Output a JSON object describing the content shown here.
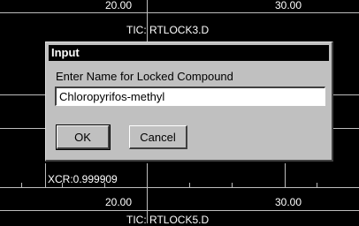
{
  "plot_top": {
    "tick_left": "20.00",
    "tick_right": "30.00",
    "trace_label": "TIC: RTLOCK3.D"
  },
  "plot_bottom": {
    "xcr_label": "XCR:0.999909",
    "tick_left": "20.00",
    "tick_right": "30.00",
    "trace_label": "TIC: RTLOCK5.D"
  },
  "dialog": {
    "title": "Input",
    "prompt": "Enter Name for Locked Compound",
    "input_value": "Chloropyrifos-methyl",
    "ok_label": "OK",
    "cancel_label": "Cancel"
  }
}
